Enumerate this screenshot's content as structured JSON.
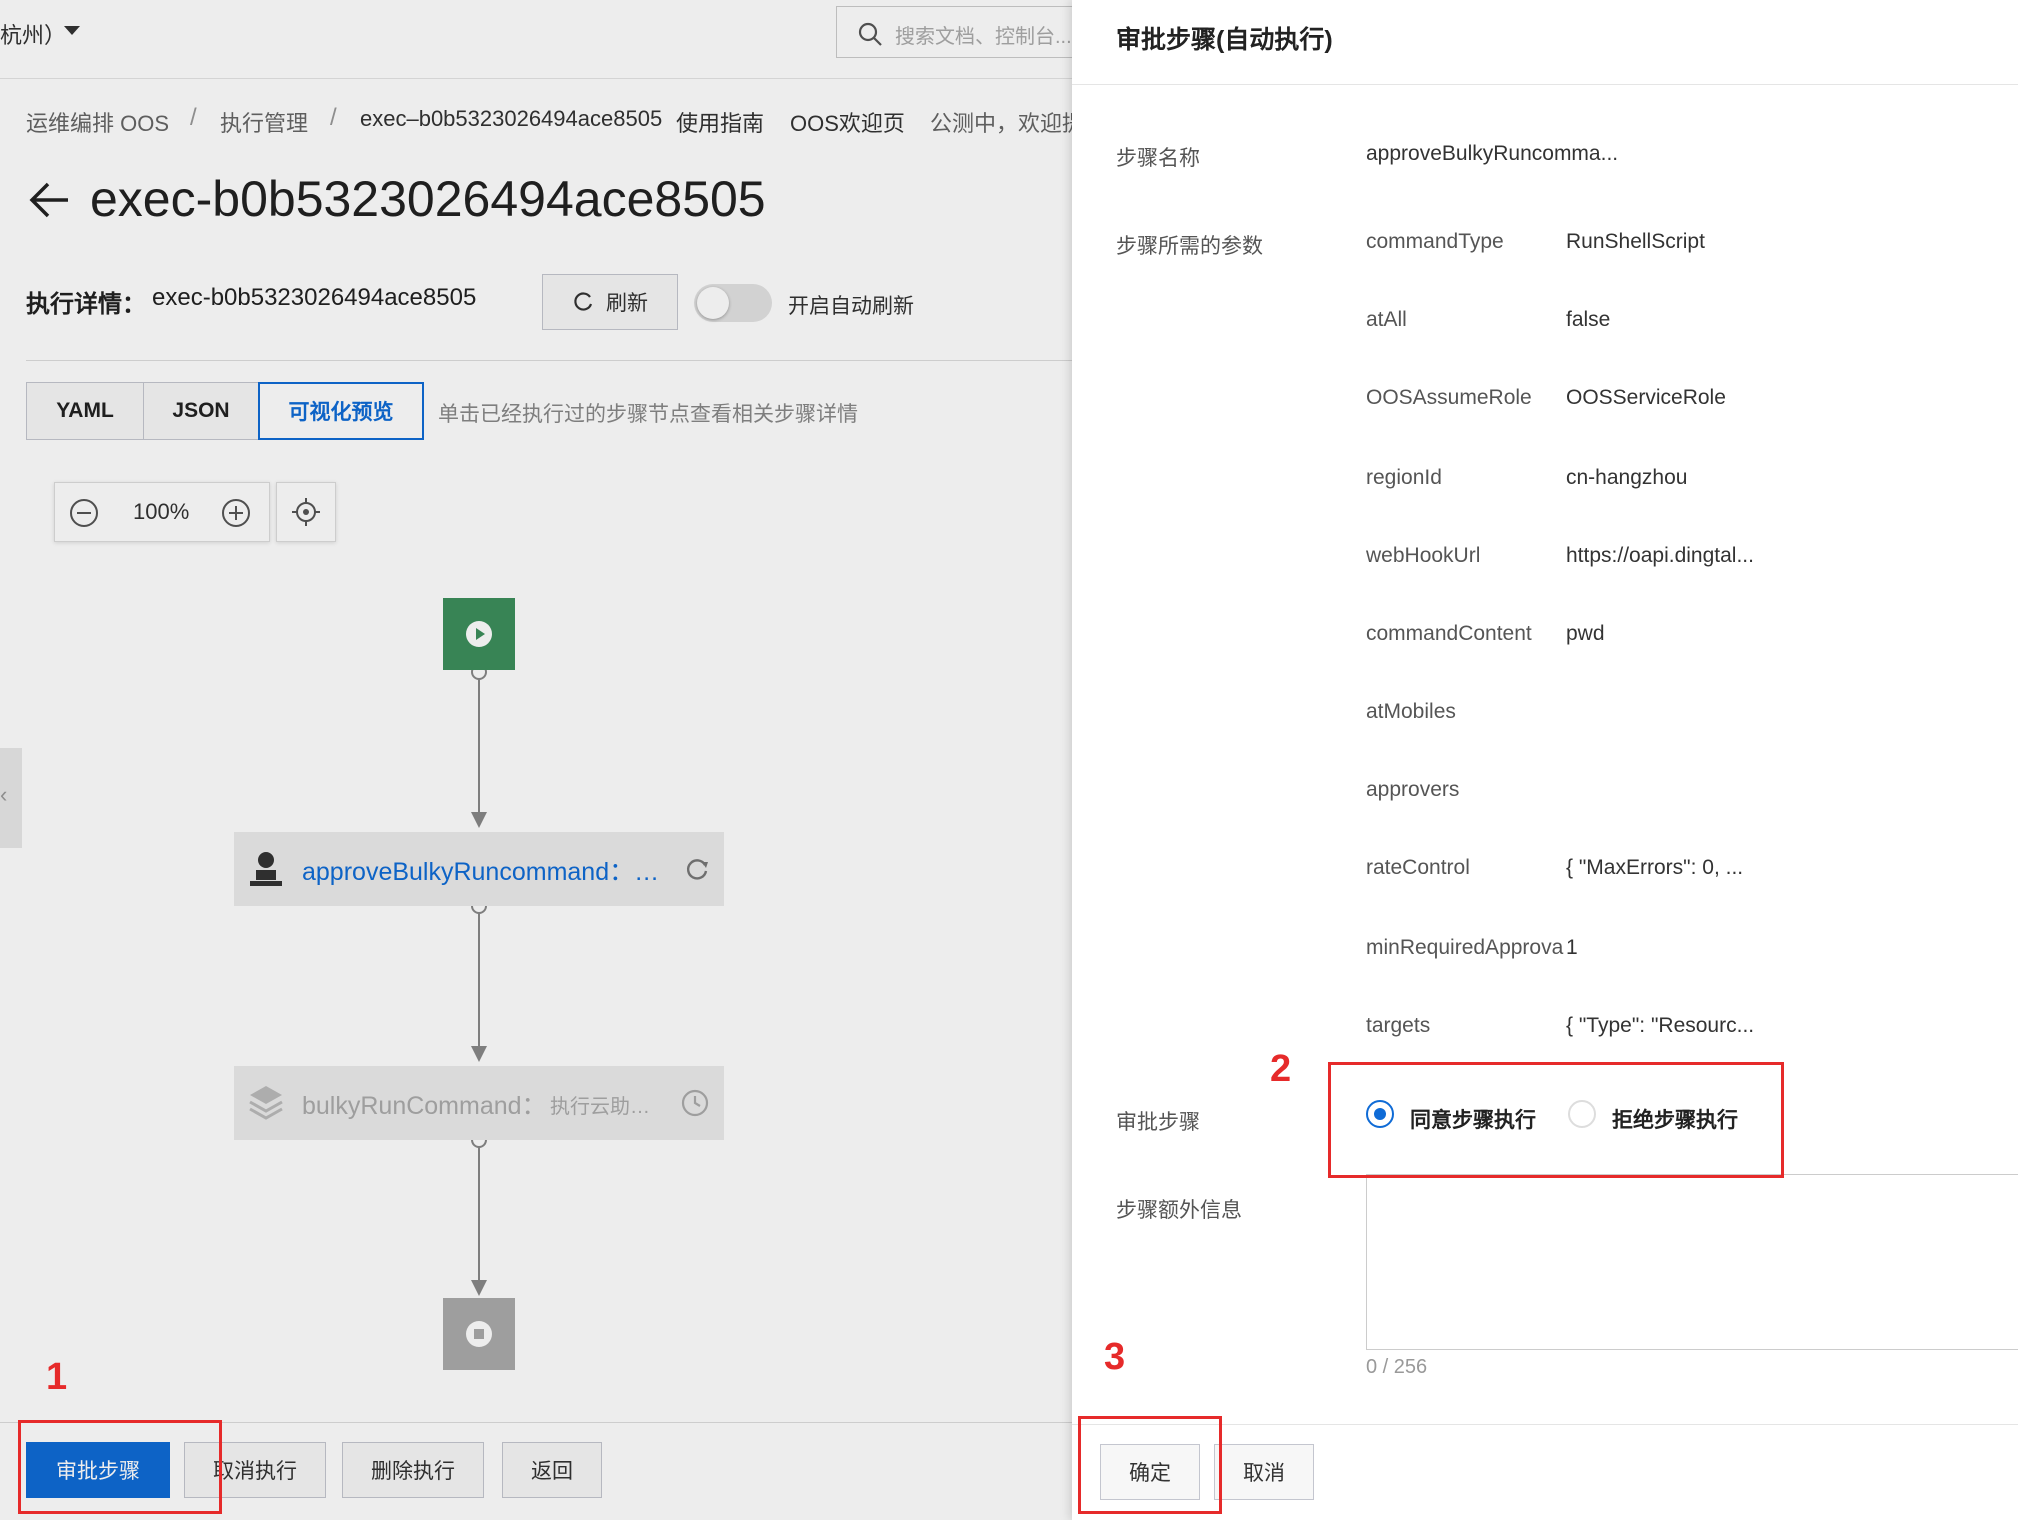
{
  "topbar": {
    "region": "杭州）",
    "search_placeholder": "搜索文档、控制台..."
  },
  "breadcrumb": [
    "运维编排 OOS",
    "执行管理",
    "exec–b0b5323026494ace8505"
  ],
  "top_links": [
    "使用指南",
    "OOS欢迎页",
    "公测中，欢迎提"
  ],
  "page_title": "exec-b0b5323026494ace8505",
  "detail": {
    "label": "执行详情：",
    "id": "exec-b0b5323026494ace8505",
    "refresh": "刷新",
    "auto_refresh": "开启自动刷新"
  },
  "tabs": [
    "YAML",
    "JSON",
    "可视化预览"
  ],
  "tabs_hint": "单击已经执行过的步骤节点查看相关步骤详情",
  "zoom": "100%",
  "nodes": {
    "approve": "approveBulkyRuncommand：…",
    "bulky_name": "bulkyRunCommand：",
    "bulky_desc": "执行云助…"
  },
  "footer_buttons": [
    "审批步骤",
    "取消执行",
    "删除执行",
    "返回"
  ],
  "drawer": {
    "title": "审批步骤(自动执行)",
    "step_name_label": "步骤名称",
    "step_name": "approveBulkyRuncomma...",
    "params_label": "步骤所需的参数",
    "params": [
      {
        "name": "commandType",
        "value": "RunShellScript"
      },
      {
        "name": "atAll",
        "value": "false"
      },
      {
        "name": "OOSAssumeRole",
        "value": "OOSServiceRole"
      },
      {
        "name": "regionId",
        "value": "cn-hangzhou"
      },
      {
        "name": "webHookUrl",
        "value": "https://oapi.dingtal..."
      },
      {
        "name": "commandContent",
        "value": "pwd"
      },
      {
        "name": "atMobiles",
        "value": ""
      },
      {
        "name": "approvers",
        "value": ""
      },
      {
        "name": "rateControl",
        "value": "{ \"MaxErrors\": 0, ..."
      },
      {
        "name": "minRequiredApprovals",
        "value": "1"
      },
      {
        "name": "targets",
        "value": "{ \"Type\": \"Resourc..."
      }
    ],
    "approve_label": "审批步骤",
    "approve_option": "同意步骤执行",
    "reject_option": "拒绝步骤执行",
    "extra_label": "步骤额外信息",
    "counter": "0 / 256",
    "confirm": "确定",
    "cancel": "取消"
  },
  "annotations": [
    "1",
    "2",
    "3"
  ],
  "colors": {
    "primary": "#0f6bd6",
    "start_node": "#3d8f5c",
    "annotation": "#e62a2a"
  }
}
